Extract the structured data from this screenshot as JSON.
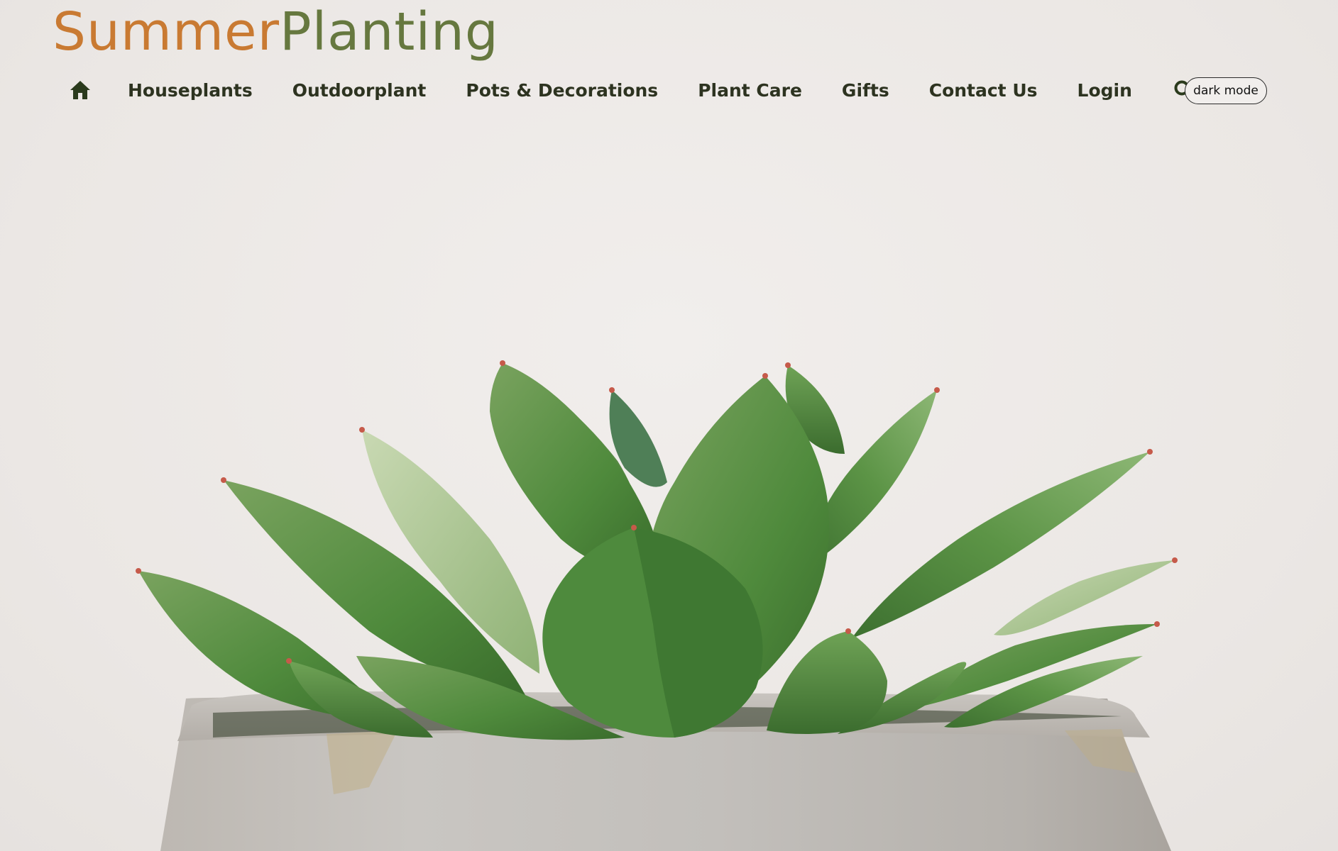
{
  "brand": {
    "name_part1": "Summer",
    "name_part2": "Planting",
    "color_part1": "#c97a32",
    "color_part2": "#66783f"
  },
  "nav": {
    "home_icon": "home-icon",
    "links": [
      {
        "label": "Houseplants"
      },
      {
        "label": "Outdoorplant"
      },
      {
        "label": "Pots & Decorations"
      },
      {
        "label": "Plant Care"
      },
      {
        "label": "Gifts"
      },
      {
        "label": "Contact Us"
      },
      {
        "label": "Login"
      }
    ],
    "search_icon": "search-icon",
    "cart_icon": "cart-icon",
    "dark_mode_label": "dark mode"
  },
  "hero": {
    "image": "succulent-in-concrete-pot"
  }
}
